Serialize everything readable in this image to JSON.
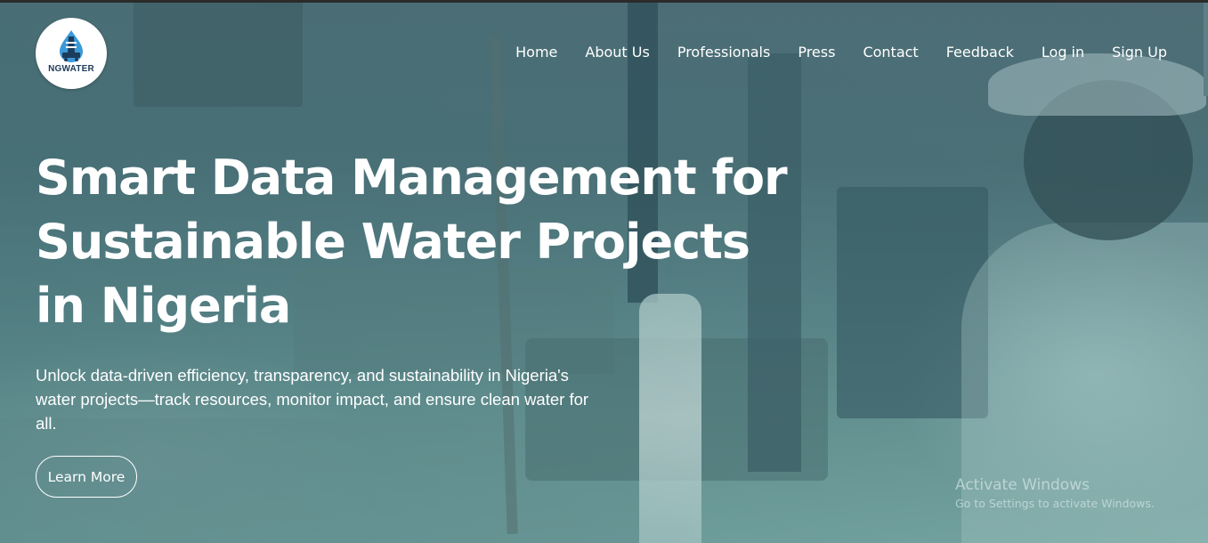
{
  "brand": {
    "logo_text": "NGWATER",
    "logo_icon": "water-drop-drilling-rig-icon"
  },
  "nav": {
    "items": [
      {
        "label": "Home"
      },
      {
        "label": "About Us"
      },
      {
        "label": "Professionals"
      },
      {
        "label": "Press"
      },
      {
        "label": "Contact"
      },
      {
        "label": "Feedback"
      },
      {
        "label": "Log in"
      },
      {
        "label": "Sign Up"
      }
    ]
  },
  "hero": {
    "title_line1": "Smart Data Management for",
    "title_line2": "Sustainable Water Projects",
    "title_line3": "in Nigeria",
    "description": "Unlock data-driven efficiency, transparency, and sustainability in Nigeria's water projects—track resources, monitor impact, and ensure clean water for all.",
    "cta_label": "Learn More",
    "background": "borehole-drilling-rig-photo"
  },
  "watermark": {
    "title": "Activate Windows",
    "subtitle": "Go to Settings to activate Windows."
  },
  "colors": {
    "overlay_teal": "#4d7c80",
    "text": "#ffffff",
    "logo_bg": "#ffffff",
    "logo_blue": "#1d3b5a",
    "drop_blue": "#3a9ad9"
  }
}
